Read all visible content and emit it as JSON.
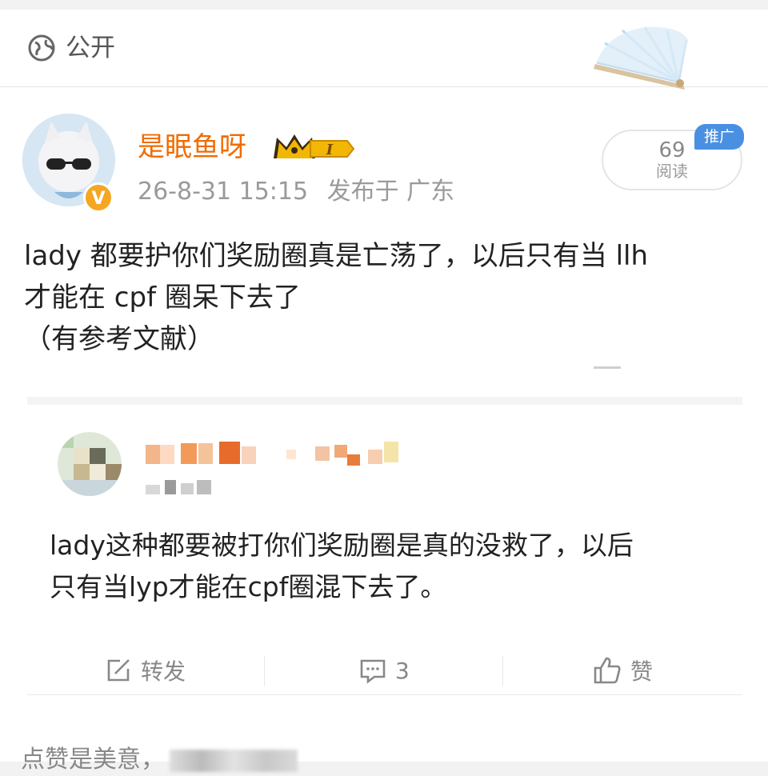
{
  "header": {
    "visibility_icon": "globe-icon",
    "visibility_label": "公开",
    "decor_icon": "folding-fan-icon"
  },
  "post": {
    "username": "是眠鱼呀",
    "member_badge": "crown-icon",
    "member_level": "I",
    "verified_badge": "V",
    "timestamp": "26-8-31 15:15",
    "location": "发布于 广东",
    "read_count": "69",
    "read_label": "阅读",
    "promo_label": "推广",
    "text_lines": [
      "lady 都要护你们奖励圈真是亡荡了，以后只有当 llh",
      "才能在 cpf 圈呆下去了",
      "（有参考文献）"
    ]
  },
  "repost": {
    "text_lines": [
      "lady这种都要被打你们奖励圈是真的没救了，以后",
      "只有当lyp才能在cpf圈混下去了。"
    ]
  },
  "actions": {
    "forward_label": "转发",
    "comment_count": "3",
    "like_label": "赞"
  },
  "footer": {
    "text": "点赞是美意，"
  },
  "colors": {
    "username": "#f06c00",
    "promo": "#4a90e2",
    "verified": "#f5a623",
    "muted": "#9a9a9a"
  }
}
